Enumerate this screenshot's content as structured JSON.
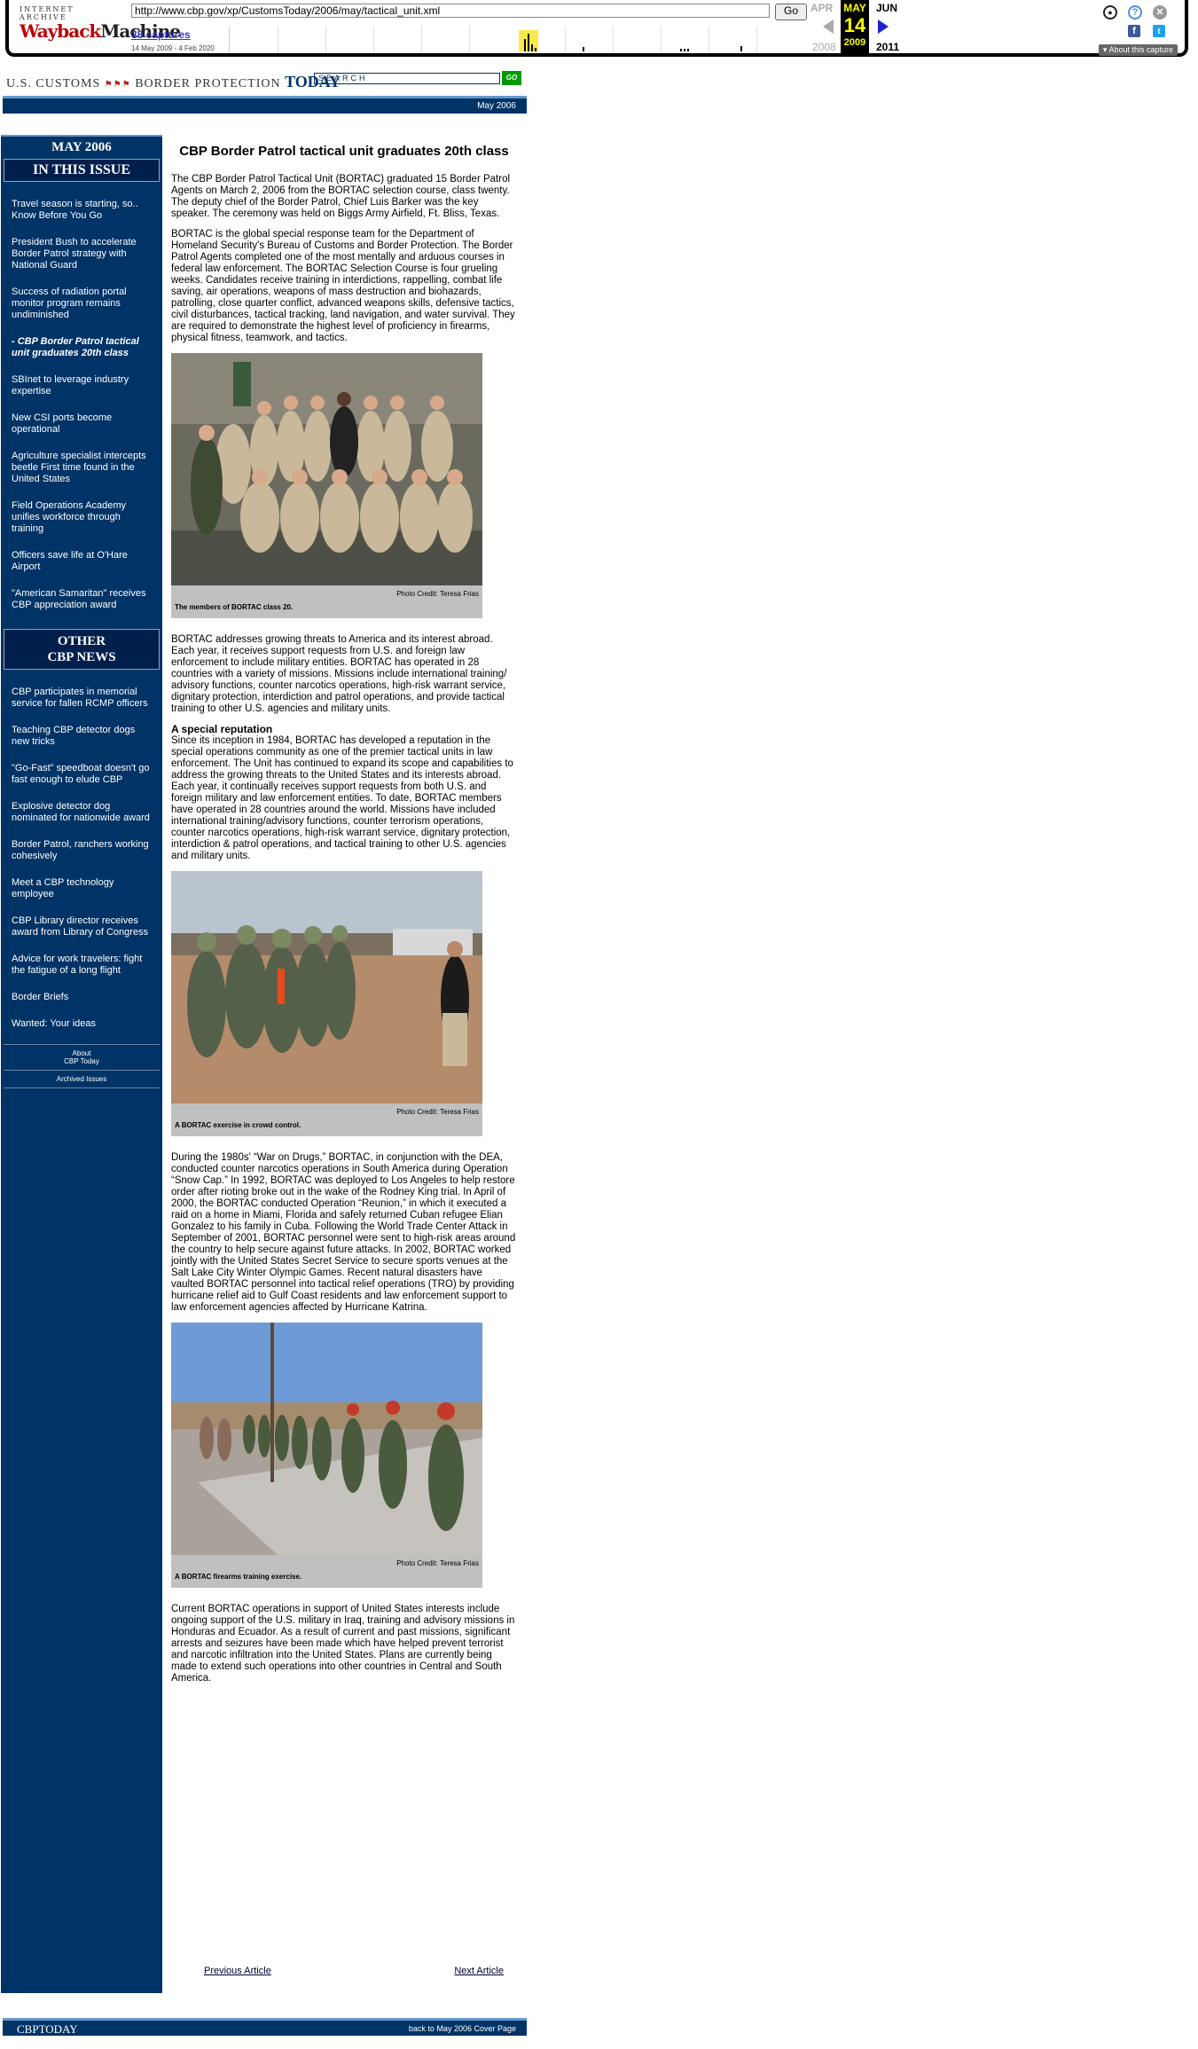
{
  "wayback": {
    "logo_top": "INTERNET ARCHIVE",
    "logo_main": "Wayback",
    "logo_main2": "Machine",
    "url": "http://www.cbp.gov/xp/CustomsToday/2006/may/tactical_unit.xml",
    "go_label": "Go",
    "captures": "38 captures",
    "range": "14 May 2009 - 4 Feb 2020",
    "prev_month": "APR",
    "cur_month": "MAY",
    "next_month": "JUN",
    "cur_day": "14",
    "prev_year": "2008",
    "cur_year": "2009",
    "next_year": "2011",
    "about": "About this capture"
  },
  "header": {
    "logo_left": "U.S. CUSTOMS",
    "logo_mid": "BORDER PROTECTION",
    "logo_today": "TODAY",
    "search_placeholder": "SEARCH",
    "go": "GO",
    "date": "May 2006"
  },
  "sidebar": {
    "month": "MAY 2006",
    "in_this_issue": "IN THIS ISSUE",
    "issue_items": [
      {
        "label": "Travel season is starting, so.. Know Before You Go"
      },
      {
        "label": "President Bush to accelerate Border Patrol strategy with National Guard"
      },
      {
        "label": "Success of radiation portal monitor program remains undiminished"
      },
      {
        "label": "- CBP Border Patrol tactical unit graduates 20th class"
      },
      {
        "label": "SBInet to leverage industry expertise"
      },
      {
        "label": "New CSI ports become operational"
      },
      {
        "label": "Agriculture specialist intercepts beetle First time found in the United States"
      },
      {
        "label": "Field Operations Academy unifies workforce through training"
      },
      {
        "label": "Officers save life at O'Hare Airport"
      },
      {
        "label": "\"American Samaritan\" receives CBP appreciation award"
      }
    ],
    "other_news_1": "OTHER",
    "other_news_2": "CBP NEWS",
    "news_items": [
      {
        "label": "CBP participates in memorial service for fallen RCMP officers"
      },
      {
        "label": "Teaching CBP detector dogs new tricks"
      },
      {
        "label": "\"Go-Fast\" speedboat doesn't go fast enough to elude CBP"
      },
      {
        "label": "Explosive detector dog nominated for nationwide award"
      },
      {
        "label": "Border Patrol, ranchers working cohesively"
      },
      {
        "label": "Meet a CBP technology employee"
      },
      {
        "label": "CBP Library director receives award from Library of Congress"
      },
      {
        "label": "Advice for work travelers: fight the fatigue of a long flight"
      },
      {
        "label": "Border Briefs"
      },
      {
        "label": "Wanted: Your ideas"
      }
    ],
    "about_1": "About",
    "about_2": "CBP Today",
    "archived": "Archived Issues"
  },
  "article": {
    "title": "CBP Border Patrol tactical unit graduates 20th class",
    "p1": "The CBP Border Patrol Tactical Unit (BORTAC) graduated 15 Border Patrol Agents on March 2, 2006 from the BORTAC selection course, class twenty. The deputy chief of the Border Patrol, Chief Luis Barker was the key speaker. The ceremony was held on Biggs Army Airfield, Ft. Bliss, Texas.",
    "p2": "BORTAC is the global special response team for the Department of Homeland Security's Bureau of Customs and Border Protection. The Border Patrol Agents completed one of the most mentally and arduous courses in federal law enforcement. The BORTAC Selection Course is four grueling weeks. Candidates receive training in interdictions, rappelling, combat life saving, air operations, weapons of mass destruction and biohazards, patrolling, close quarter conflict, advanced weapons skills, defensive tactics, civil disturbances, tactical tracking, land navigation, and water survival. They are required to demonstrate the highest level of proficiency in firearms, physical fitness, teamwork, and tactics.",
    "photo1_credit": "Photo Credit: Teresa Frias",
    "photo1_caption": "The members of BORTAC class 20.",
    "p3": "BORTAC addresses growing threats to America and its interest abroad. Each year, it receives support requests from U.S. and foreign law enforcement to include military entities. BORTAC has operated in 28 countries with a variety of missions. Missions include international training/ advisory functions, counter narcotics operations, high-risk warrant service, dignitary protection, interdiction and patrol operations, and provide tactical training to other U.S. agencies and military units.",
    "sub1": "A special reputation",
    "p4": "Since its inception in 1984, BORTAC has developed a reputation in the special operations community as one of the premier tactical units in law enforcement. The Unit has continued to expand its scope and capabilities to address the growing threats to the United States and its interests abroad. Each year, it continually receives support requests from both U.S. and foreign military and law enforcement entities. To date, BORTAC members have operated in 28 countries around the world. Missions have included international training/advisory functions, counter terrorism operations, counter narcotics operations, high-risk warrant service, dignitary protection, interdiction & patrol operations, and tactical training to other U.S. agencies and military units.",
    "photo2_credit": "Photo Credit: Teresa Frias",
    "photo2_caption": "A BORTAC exercise in crowd control.",
    "p5": "During the 1980s' “War on Drugs,” BORTAC, in conjunction with the DEA, conducted counter narcotics operations in South America during Operation “Snow Cap.” In 1992, BORTAC was deployed to Los Angeles to help restore order after rioting broke out in the wake of the Rodney King trial. In April of 2000, the BORTAC conducted Operation “Reunion,” in which it executed a raid on a home in Miami, Florida and safely returned Cuban refugee Elian Gonzalez to his family in Cuba. Following the World Trade Center Attack in September of 2001, BORTAC personnel were sent to high-risk areas around the country to help secure against future attacks. In 2002, BORTAC worked jointly with the United States Secret Service to secure sports venues at the Salt Lake City Winter Olympic Games. Recent natural disasters have vaulted BORTAC personnel into tactical relief operations (TRO) by providing hurricane relief aid to Gulf Coast residents and law enforcement support to law enforcement agencies affected by Hurricane Katrina.",
    "photo3_credit": "Photo Credit: Teresa Frias",
    "photo3_caption": "A BORTAC firearms training exercise.",
    "p6": "Current BORTAC operations in support of United States interests include ongoing support of the U.S. military in Iraq, training and advisory missions in Honduras and Ecuador. As a result of current and past missions, significant arrests and seizures have been made which have helped prevent terrorist and narcotic infiltration into the United States. Plans are currently being made to extend such operations into other countries in Central and South America."
  },
  "nav": {
    "prev": "Previous Article",
    "next": "Next Article"
  },
  "footer": {
    "left": "CBPTODAY",
    "right": "back to May 2006 Cover Page"
  }
}
